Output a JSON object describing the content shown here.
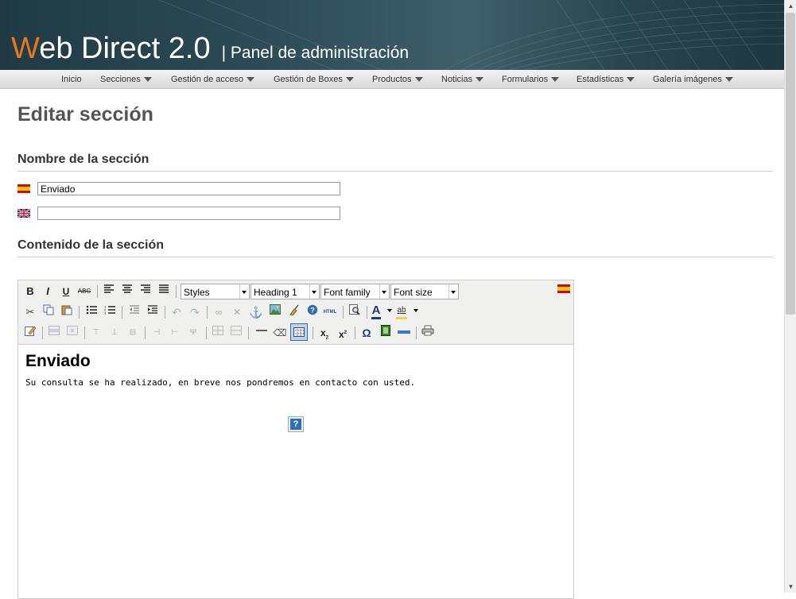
{
  "header": {
    "brand_first_letter": "W",
    "brand_rest": "eb Direct 2.0",
    "subtitle": "| Panel de administración",
    "accent_color": "#e8761c"
  },
  "nav": {
    "items": [
      {
        "label": "Inicio",
        "has_dropdown": false
      },
      {
        "label": "Secciones",
        "has_dropdown": true
      },
      {
        "label": "Gestión de acceso",
        "has_dropdown": true
      },
      {
        "label": "Gestión de Boxes",
        "has_dropdown": true
      },
      {
        "label": "Productos",
        "has_dropdown": true
      },
      {
        "label": "Noticias",
        "has_dropdown": true
      },
      {
        "label": "Formularios",
        "has_dropdown": true
      },
      {
        "label": "Estadísticas",
        "has_dropdown": true
      },
      {
        "label": "Galería imágenes",
        "has_dropdown": true
      }
    ]
  },
  "page": {
    "title": "Editar sección",
    "name_section_heading": "Nombre de la sección",
    "content_section_heading": "Contenido de la sección",
    "name_es_value": "Enviado",
    "name_en_value": ""
  },
  "editor": {
    "styles_select": "Styles",
    "format_select": "Heading 1",
    "font_family_select": "Font family",
    "font_size_select": "Font size",
    "language_flag": "spain-flag-icon",
    "content_heading": "Enviado",
    "content_text": "Su consulta se ha realizado, en breve nos pondremos en contacto con usted.",
    "embedded_icon": "help-icon",
    "icons_row1": [
      "bold-icon",
      "italic-icon",
      "underline-icon",
      "strikethrough-icon",
      "align-left-icon",
      "align-center-icon",
      "align-right-icon",
      "align-justify-icon"
    ],
    "icons_row2": [
      "cut-icon",
      "copy-icon",
      "paste-icon",
      "bullet-list-icon",
      "numbered-list-icon",
      "outdent-icon",
      "indent-icon",
      "undo-icon",
      "redo-icon",
      "link-icon",
      "unlink-icon",
      "anchor-icon",
      "image-icon",
      "cleanup-icon",
      "help-icon",
      "html-source-icon",
      "find-replace-icon",
      "text-color-icon",
      "background-color-icon"
    ],
    "icons_row3": [
      "edit-document-icon",
      "table-row-props-icon",
      "table-cell-props-icon",
      "insert-row-before-icon",
      "insert-row-after-icon",
      "delete-row-icon",
      "insert-column-before-icon",
      "insert-column-after-icon",
      "delete-column-icon",
      "split-cells-icon",
      "merge-cells-icon",
      "horizontal-rule-icon",
      "remove-format-icon",
      "visual-aid-icon",
      "subscript-icon",
      "superscript-icon",
      "special-char-icon",
      "media-icon",
      "advanced-hr-icon",
      "print-icon"
    ]
  },
  "labels": {
    "strike_glyph": "ABC",
    "html_glyph": "HTML",
    "omega_glyph": "Ω",
    "text_color_glyph": "A",
    "bg_color_glyph": "ab",
    "help_glyph": "?"
  }
}
